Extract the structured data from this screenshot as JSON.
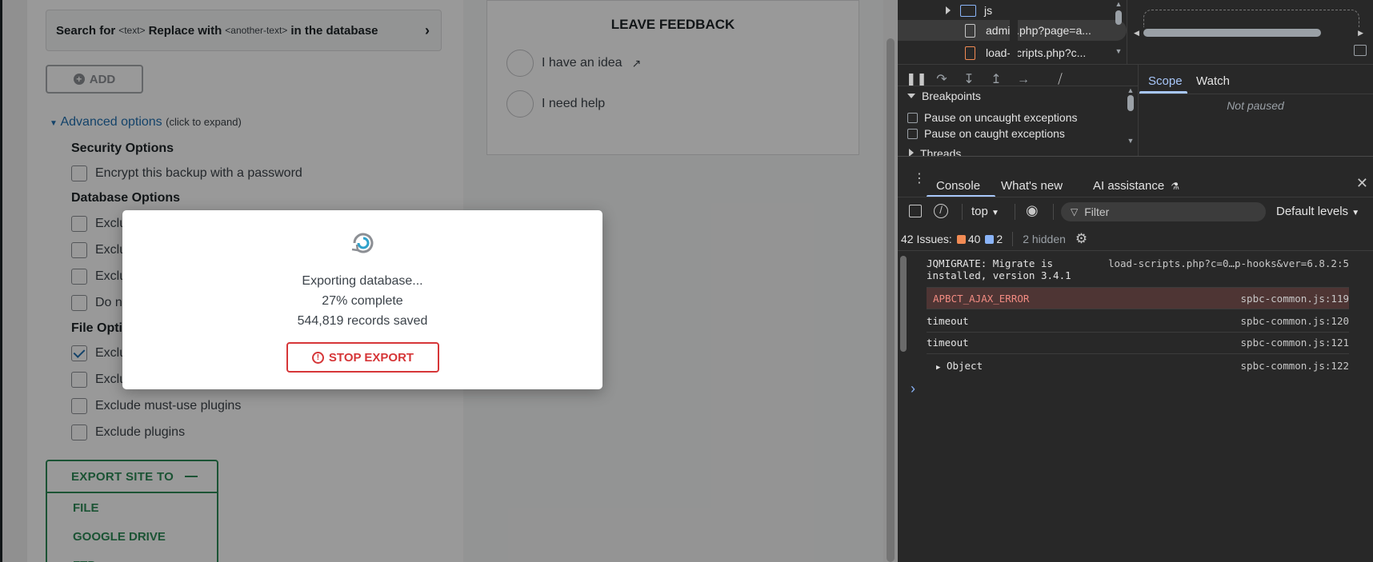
{
  "wp": {
    "search_card": {
      "prefix": "Search for",
      "text_tag": "<text>",
      "replace": "Replace with",
      "another_tag": "<another-text>",
      "suffix": "in the database"
    },
    "add_button": "ADD",
    "advanced": {
      "label": "Advanced options",
      "hint": "(click to expand)"
    },
    "security_heading": "Security Options",
    "encrypt_label": "Encrypt this backup with a password",
    "database_heading": "Database Options",
    "db_options": [
      "Exclu",
      "Exclu",
      "Exclu",
      "Do n"
    ],
    "file_heading": "File Optio",
    "file_options": [
      {
        "label": "Exclu",
        "checked": true
      },
      {
        "label": "Exclu",
        "checked": false
      },
      {
        "label": "Exclude must-use plugins",
        "checked": false
      },
      {
        "label": "Exclude plugins",
        "checked": false
      }
    ],
    "export": {
      "title": "EXPORT SITE TO",
      "items": [
        "FILE",
        "GOOGLE DRIVE",
        "FTP"
      ]
    },
    "feedback": {
      "title": "LEAVE FEEDBACK",
      "idea": "I have an idea",
      "help": "I need help"
    }
  },
  "modal": {
    "status": "Exporting database...",
    "progress": "27% complete",
    "progress_value": 0.27,
    "records": "544,819 records saved",
    "stop_button": "STOP EXPORT"
  },
  "devtools": {
    "tree": [
      {
        "label": "js",
        "type": "folder"
      },
      {
        "label": "admin.php?page=a...",
        "type": "file",
        "selected": true
      },
      {
        "label": "load-scripts.php?c...",
        "type": "file-orange"
      }
    ],
    "scope_tab": "Scope",
    "watch_tab": "Watch",
    "not_paused": "Not paused",
    "breakpoints_heading": "Breakpoints",
    "pause_uncaught": "Pause on uncaught exceptions",
    "pause_caught": "Pause on caught exceptions",
    "threads": "Threads",
    "drawer_tabs": {
      "console": "Console",
      "whats_new": "What's new",
      "ai": "AI assistance"
    },
    "context": "top",
    "filter_placeholder": "Filter",
    "levels": "Default levels",
    "issues": {
      "label": "42 Issues:",
      "errors": "40",
      "info": "2",
      "hidden": "2 hidden"
    },
    "console": [
      {
        "text": "JQMIGRATE: Migrate is",
        "text2": "installed, version 3.4.1",
        "src": "load-scripts.php?c=0…p-hooks&ver=6.8.2:5"
      },
      {
        "text": "APBCT_AJAX_ERROR",
        "src": "spbc-common.js:119",
        "error": true
      },
      {
        "text": "timeout",
        "src": "spbc-common.js:120"
      },
      {
        "text": "timeout",
        "src": "spbc-common.js:121"
      },
      {
        "text": "Object",
        "src": "spbc-common.js:122"
      }
    ],
    "prompt": "›",
    "colors": {
      "accent": "#a8c7fa",
      "error": "#f28b82",
      "panel": "#282828"
    }
  }
}
